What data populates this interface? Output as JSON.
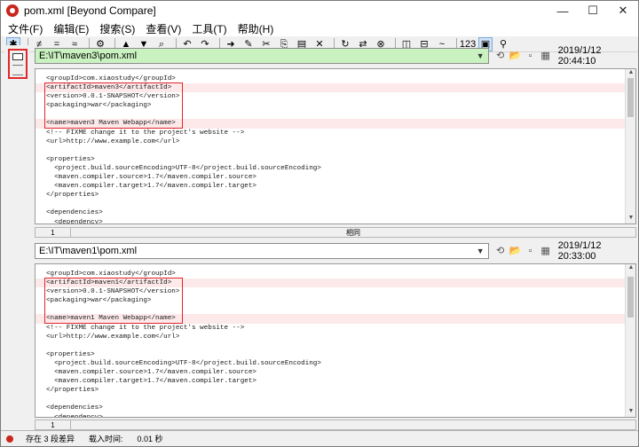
{
  "window": {
    "title": "pom.xml  [Beyond Compare]",
    "controls": [
      "—",
      "☐",
      "✕"
    ]
  },
  "menu": [
    "文件(F)",
    "编辑(E)",
    "搜索(S)",
    "查看(V)",
    "工具(T)",
    "帮助(H)"
  ],
  "toolbar": [
    {
      "name": "all-diffs-icon",
      "glyph": "✱",
      "active": true
    },
    {
      "name": "diffs-icon",
      "glyph": "≠"
    },
    {
      "name": "same-icon",
      "glyph": "="
    },
    {
      "name": "approx-icon",
      "glyph": "≈"
    },
    {
      "name": "rules-icon",
      "glyph": "⚙"
    },
    {
      "name": "prev-diff-icon",
      "glyph": "▲"
    },
    {
      "name": "next-diff-icon",
      "glyph": "▼"
    },
    {
      "name": "binoculars-icon",
      "glyph": "⌕"
    },
    {
      "name": "undo-icon",
      "glyph": "↶"
    },
    {
      "name": "redo-icon",
      "glyph": "↷"
    },
    {
      "name": "copy-right-icon",
      "glyph": "➜"
    },
    {
      "name": "edit-icon",
      "glyph": "✎"
    },
    {
      "name": "cut-icon",
      "glyph": "✂"
    },
    {
      "name": "copy-icon",
      "glyph": "⎘"
    },
    {
      "name": "paste-icon",
      "glyph": "▤"
    },
    {
      "name": "delete-icon",
      "glyph": "✕"
    },
    {
      "name": "refresh-icon",
      "glyph": "↻"
    },
    {
      "name": "swap-icon",
      "glyph": "⇄"
    },
    {
      "name": "stop-icon",
      "glyph": "⊗"
    },
    {
      "name": "split-vertical-icon",
      "glyph": "◫"
    },
    {
      "name": "split-horizontal-icon",
      "glyph": "⊟"
    },
    {
      "name": "wave-icon",
      "glyph": "~"
    },
    {
      "name": "line-numbers-icon",
      "glyph": "123"
    },
    {
      "name": "view-toggle-icon",
      "glyph": "▣",
      "active": true
    },
    {
      "name": "zoom-icon",
      "glyph": "⚲"
    }
  ],
  "top_pane": {
    "path": "E:\\IT\\maven3\\pom.xml",
    "timestamp": "2019/1/12 20:44:10",
    "lines": [
      {
        "text": "<groupId>com.xiaostudy</groupId>",
        "diff": false
      },
      {
        "text": "<artifactId>maven3</artifactId>",
        "diff": true
      },
      {
        "text": "<version>0.0.1-SNAPSHOT</version>",
        "diff": false
      },
      {
        "text": "<packaging>war</packaging>",
        "diff": false
      },
      {
        "text": "",
        "diff": false
      },
      {
        "text": "<name>maven3 Maven Webapp</name>",
        "diff": true
      },
      {
        "text": "<!-- FIXME change it to the project's website -->",
        "diff": false
      },
      {
        "text": "<url>http://www.example.com</url>",
        "diff": false
      },
      {
        "text": "",
        "diff": false
      },
      {
        "text": "<properties>",
        "diff": false
      },
      {
        "text": "  <project.build.sourceEncoding>UTF-8</project.build.sourceEncoding>",
        "diff": false
      },
      {
        "text": "  <maven.compiler.source>1.7</maven.compiler.source>",
        "diff": false
      },
      {
        "text": "  <maven.compiler.target>1.7</maven.compiler.target>",
        "diff": false
      },
      {
        "text": "</properties>",
        "diff": false
      },
      {
        "text": "",
        "diff": false
      },
      {
        "text": "<dependencies>",
        "diff": false
      },
      {
        "text": "  <dependency>",
        "diff": false
      }
    ],
    "line_number": "1",
    "status": "相同"
  },
  "bottom_pane": {
    "path": "E:\\IT\\maven1\\pom.xml",
    "timestamp": "2019/1/12 20:33:00",
    "lines": [
      {
        "text": "<groupId>com.xiaostudy</groupId>",
        "diff": false
      },
      {
        "text": "<artifactId>maven1</artifactId>",
        "diff": true
      },
      {
        "text": "<version>0.0.1-SNAPSHOT</version>",
        "diff": false
      },
      {
        "text": "<packaging>war</packaging>",
        "diff": false
      },
      {
        "text": "",
        "diff": false
      },
      {
        "text": "<name>maven1 Maven Webapp</name>",
        "diff": true
      },
      {
        "text": "<!-- FIXME change it to the project's website -->",
        "diff": false
      },
      {
        "text": "<url>http://www.example.com</url>",
        "diff": false
      },
      {
        "text": "",
        "diff": false
      },
      {
        "text": "<properties>",
        "diff": false
      },
      {
        "text": "  <project.build.sourceEncoding>UTF-8</project.build.sourceEncoding>",
        "diff": false
      },
      {
        "text": "  <maven.compiler.source>1.7</maven.compiler.source>",
        "diff": false
      },
      {
        "text": "  <maven.compiler.target>1.7</maven.compiler.target>",
        "diff": false
      },
      {
        "text": "</properties>",
        "diff": false
      },
      {
        "text": "",
        "diff": false
      },
      {
        "text": "<dependencies>",
        "diff": false
      },
      {
        "text": "  <dependency>",
        "diff": false
      }
    ],
    "line_number": "1"
  },
  "statusbar": {
    "diff_count": "存在 3 段差异",
    "load_time_label": "载入时间:",
    "load_time_value": "0.01 秒"
  },
  "colors": {
    "diff_line_bg": "#fde9ea",
    "path_green": "#c9f2c0",
    "annotation_red": "#e0262a"
  }
}
